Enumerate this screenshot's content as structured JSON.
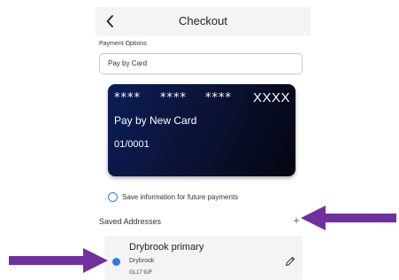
{
  "header": {
    "title": "Checkout",
    "back_icon": "chevron-left-icon"
  },
  "payment": {
    "section_label": "Payment Options",
    "selected_option": "Pay by Card"
  },
  "card": {
    "masked_groups": [
      "****",
      "****",
      "****"
    ],
    "last_group": "XXXX",
    "name": "Pay by New Card",
    "expiry": "01/0001"
  },
  "save_info": {
    "label": "Save information for future payments",
    "checked": false
  },
  "addresses": {
    "heading": "Saved Addresses",
    "add_label": "+",
    "items": [
      {
        "name": "Drybrook primary",
        "line1": "Drybrook",
        "line2": "GL17 9JF",
        "selected": true
      }
    ]
  },
  "annotations": {
    "arrow_color": "#7030a0"
  },
  "colors": {
    "accent": "#2c7be5",
    "card_dark": "#0c1338",
    "arrow": "#7030a0"
  }
}
